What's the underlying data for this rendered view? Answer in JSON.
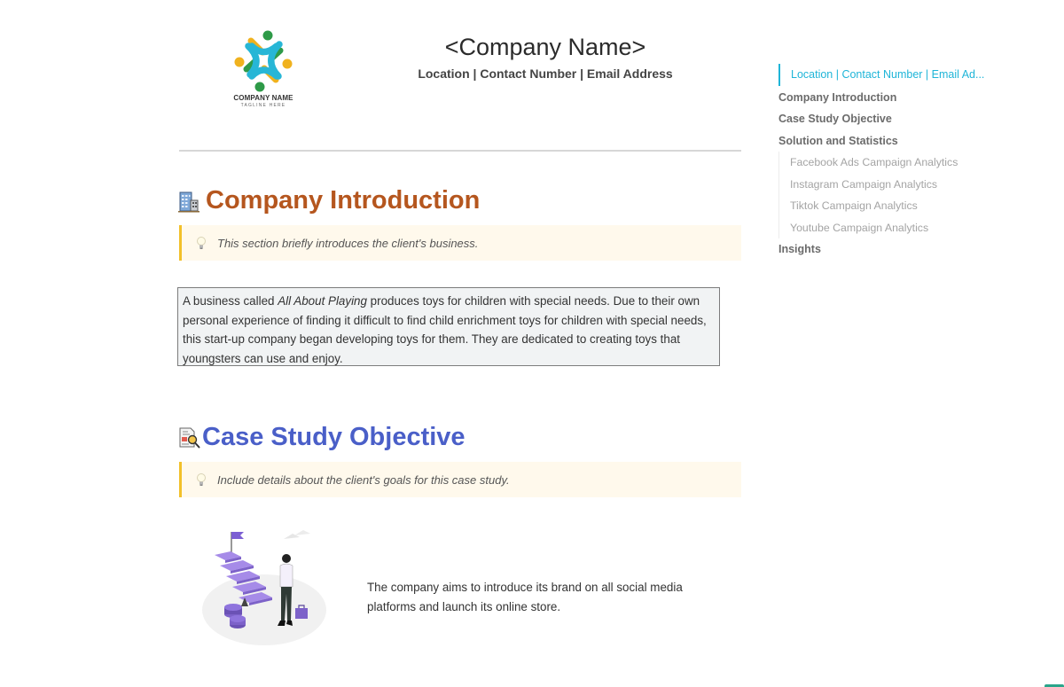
{
  "header": {
    "logo": {
      "name": "COMPANY NAME",
      "tagline": "TAGLINE HERE",
      "colors": {
        "cyan": "#27b6d6",
        "green": "#2e9a48",
        "yellow": "#f0b21e"
      }
    },
    "title": "<Company Name>",
    "subtitle": "Location | Contact Number | Email Address"
  },
  "sections": {
    "intro": {
      "icon": "office-building-icon",
      "heading": "Company Introduction",
      "heading_color": "#b5561e",
      "callout": "This section briefly introduces the client's business.",
      "body_prefix": "A business called ",
      "body_italic": "All About Playing",
      "body_suffix": " produces toys for children with special needs. Due to their own personal experience of finding it difficult to find child enrichment toys for children with special needs, this start-up company began developing toys for them. They are dedicated to creating toys that youngsters can use and enjoy."
    },
    "objective": {
      "icon": "document-search-icon",
      "heading": "Case Study Objective",
      "heading_color": "#4a5fc8",
      "callout": "Include details about the client's goals for this case study.",
      "illustration": "woman-climbing-goal-stairs-illustration",
      "body": "The company aims to introduce its brand on all social media platforms and launch its online store."
    }
  },
  "toc": {
    "active": "Location | Contact Number | Email Ad...",
    "items": [
      {
        "label": "Company Introduction"
      },
      {
        "label": "Case Study Objective"
      },
      {
        "label": "Solution and Statistics"
      }
    ],
    "subitems": [
      {
        "label": "Facebook Ads Campaign Analytics"
      },
      {
        "label": "Instagram Campaign Analytics"
      },
      {
        "label": "Tiktok Campaign Analytics"
      },
      {
        "label": "Youtube Campaign Analytics"
      }
    ],
    "last": {
      "label": "Insights"
    }
  },
  "colors": {
    "accent": "#1fb5d8",
    "callout_border": "#f2c02a",
    "callout_bg": "#fff9ec"
  }
}
